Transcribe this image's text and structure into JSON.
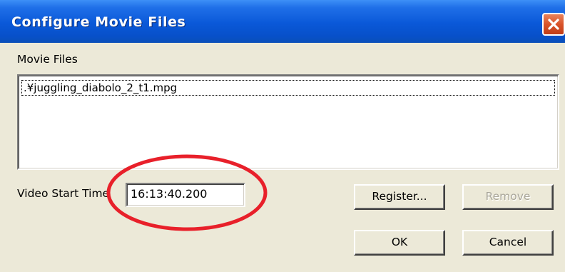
{
  "window": {
    "title": "Configure Movie Files"
  },
  "movie_files": {
    "label": "Movie Files",
    "items": [
      ".¥juggling_diabolo_2_t1.mpg"
    ]
  },
  "video_start_time": {
    "label": "Video Start Time",
    "value": "16:13:40.200"
  },
  "buttons": {
    "register_label": "Register...",
    "remove_label": "Remove",
    "ok_label": "OK",
    "cancel_label": "Cancel"
  },
  "colors": {
    "titlebar": "#0a58d8",
    "dialog_background": "#ece9d8",
    "close_button": "#d9532a",
    "annotation_circle": "#e8202a"
  },
  "icons": {
    "close": "close-icon"
  }
}
